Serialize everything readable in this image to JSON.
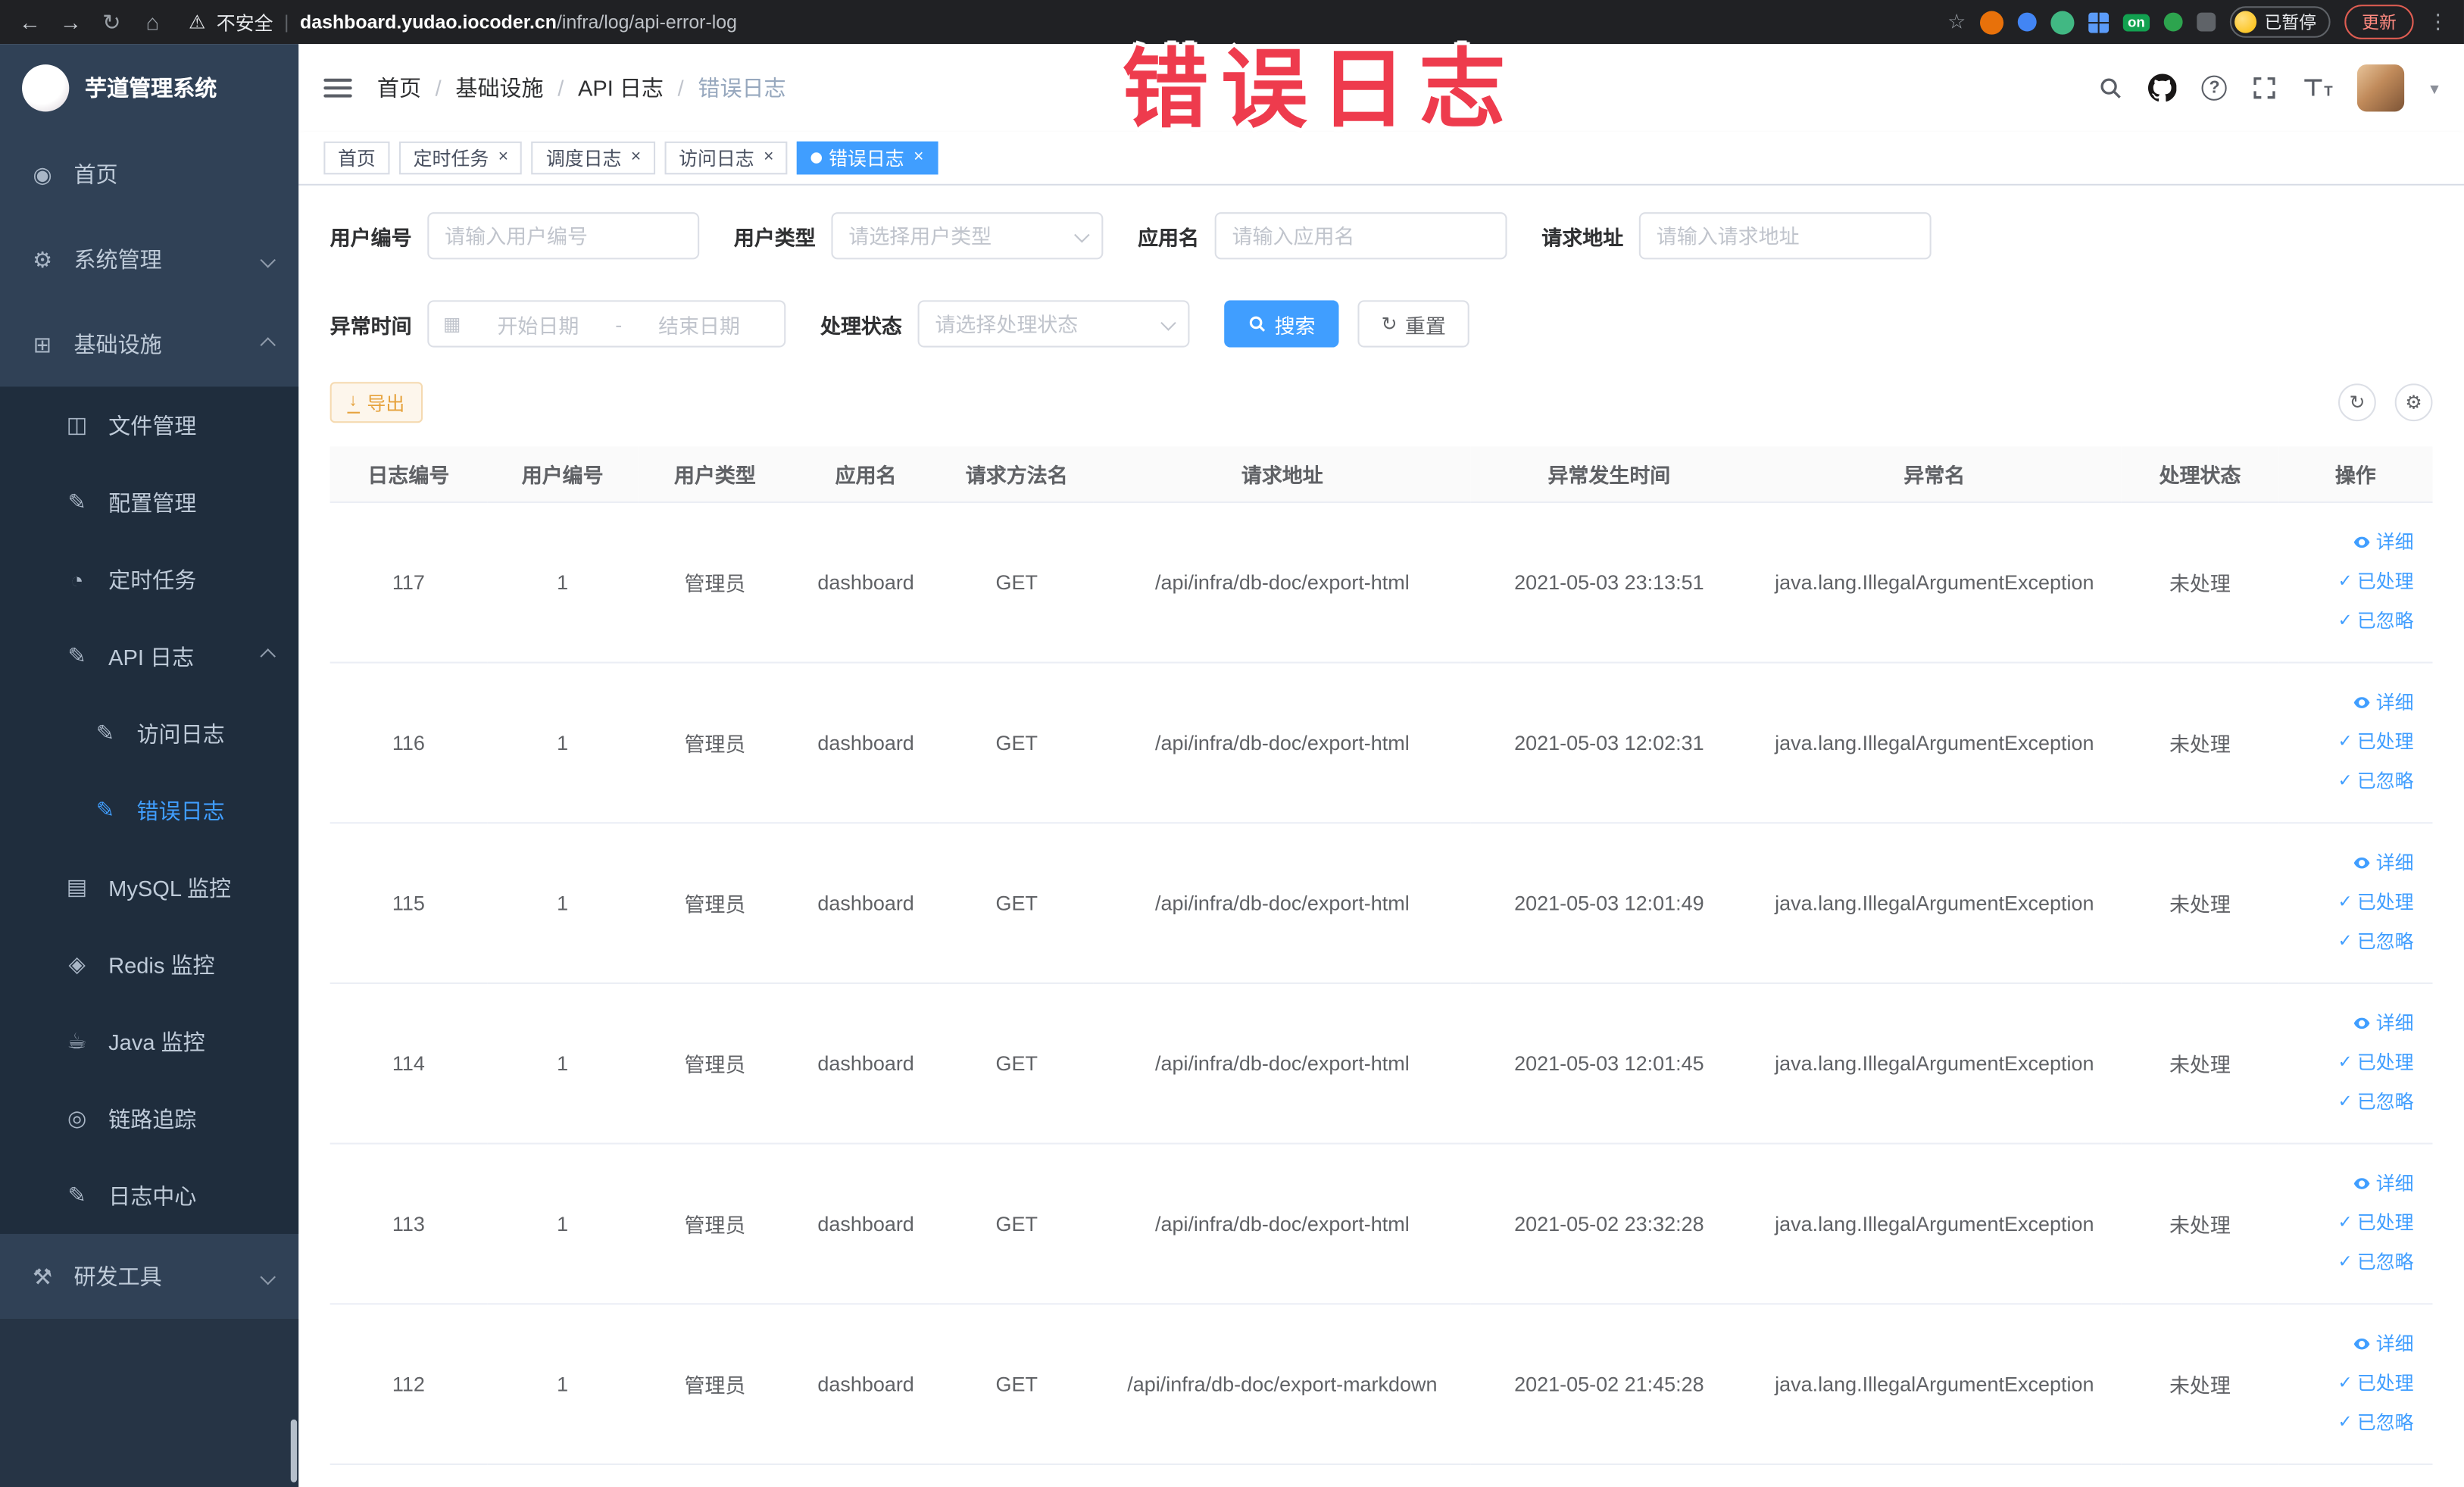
{
  "browser": {
    "security_label": "不安全",
    "url_domain": "dashboard.yudao.iocoder.cn",
    "url_path": "/infra/log/api-error-log",
    "extension_on_label": "on",
    "paused_label": "已暂停",
    "update_label": "更新"
  },
  "annotation": "错误日志",
  "sidebar": {
    "title": "芋道管理系统",
    "items": [
      {
        "label": "首页"
      },
      {
        "label": "系统管理"
      },
      {
        "label": "基础设施"
      },
      {
        "label": "文件管理"
      },
      {
        "label": "配置管理"
      },
      {
        "label": "定时任务"
      },
      {
        "label": "API 日志"
      },
      {
        "label": "访问日志"
      },
      {
        "label": "错误日志"
      },
      {
        "label": "MySQL 监控"
      },
      {
        "label": "Redis 监控"
      },
      {
        "label": "Java 监控"
      },
      {
        "label": "链路追踪"
      },
      {
        "label": "日志中心"
      },
      {
        "label": "研发工具"
      }
    ]
  },
  "breadcrumb": {
    "separator": "/",
    "items": [
      "首页",
      "基础设施",
      "API 日志",
      "错误日志"
    ]
  },
  "tabs": [
    {
      "label": "首页"
    },
    {
      "label": "定时任务"
    },
    {
      "label": "调度日志"
    },
    {
      "label": "访问日志"
    },
    {
      "label": "错误日志"
    }
  ],
  "filters": {
    "user_id_label": "用户编号",
    "user_id_placeholder": "请输入用户编号",
    "user_type_label": "用户类型",
    "user_type_placeholder": "请选择用户类型",
    "app_name_label": "应用名",
    "app_name_placeholder": "请输入应用名",
    "request_url_label": "请求地址",
    "request_url_placeholder": "请输入请求地址",
    "exception_time_label": "异常时间",
    "start_date_placeholder": "开始日期",
    "date_separator": "-",
    "end_date_placeholder": "结束日期",
    "process_status_label": "处理状态",
    "process_status_placeholder": "请选择处理状态",
    "search_label": "搜索",
    "reset_label": "重置"
  },
  "toolbar": {
    "export_label": "导出"
  },
  "table": {
    "columns": [
      "日志编号",
      "用户编号",
      "用户类型",
      "应用名",
      "请求方法名",
      "请求地址",
      "异常发生时间",
      "异常名",
      "处理状态",
      "操作"
    ],
    "row_actions": {
      "detail": "详细",
      "processed": "已处理",
      "ignored": "已忽略"
    },
    "rows": [
      {
        "id": "117",
        "user_id": "1",
        "user_type": "管理员",
        "app": "dashboard",
        "method": "GET",
        "url": "/api/infra/db-doc/export-html",
        "time": "2021-05-03 23:13:51",
        "exception": "java.lang.IllegalArgumentException",
        "status": "未处理"
      },
      {
        "id": "116",
        "user_id": "1",
        "user_type": "管理员",
        "app": "dashboard",
        "method": "GET",
        "url": "/api/infra/db-doc/export-html",
        "time": "2021-05-03 12:02:31",
        "exception": "java.lang.IllegalArgumentException",
        "status": "未处理"
      },
      {
        "id": "115",
        "user_id": "1",
        "user_type": "管理员",
        "app": "dashboard",
        "method": "GET",
        "url": "/api/infra/db-doc/export-html",
        "time": "2021-05-03 12:01:49",
        "exception": "java.lang.IllegalArgumentException",
        "status": "未处理"
      },
      {
        "id": "114",
        "user_id": "1",
        "user_type": "管理员",
        "app": "dashboard",
        "method": "GET",
        "url": "/api/infra/db-doc/export-html",
        "time": "2021-05-03 12:01:45",
        "exception": "java.lang.IllegalArgumentException",
        "status": "未处理"
      },
      {
        "id": "113",
        "user_id": "1",
        "user_type": "管理员",
        "app": "dashboard",
        "method": "GET",
        "url": "/api/infra/db-doc/export-html",
        "time": "2021-05-02 23:32:28",
        "exception": "java.lang.IllegalArgumentException",
        "status": "未处理"
      },
      {
        "id": "112",
        "user_id": "1",
        "user_type": "管理员",
        "app": "dashboard",
        "method": "GET",
        "url": "/api/infra/db-doc/export-markdown",
        "time": "2021-05-02 21:45:28",
        "exception": "java.lang.IllegalArgumentException",
        "status": "未处理"
      }
    ]
  }
}
